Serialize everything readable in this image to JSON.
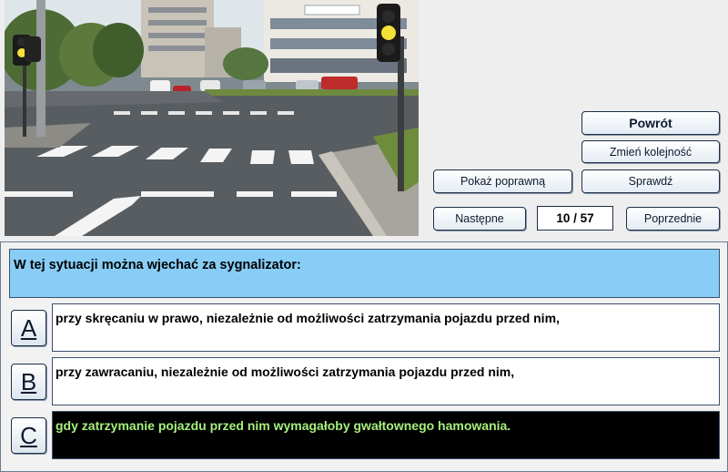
{
  "photo": {
    "alt_subject": "intersection-with-traffic-signal"
  },
  "buttons": {
    "back": "Powrót",
    "reorder": "Zmień kolejność",
    "show_correct": "Pokaż poprawną",
    "check": "Sprawdź",
    "next": "Następne",
    "previous": "Poprzednie"
  },
  "counter": "10 / 57",
  "question": "W tej sytuacji można wjechać za sygnalizator:",
  "answers": [
    {
      "letter": "A",
      "text": "przy skręcaniu w prawo, niezależnie od możliwości zatrzymania pojazdu przed nim,",
      "selected": false
    },
    {
      "letter": "B",
      "text": "przy zawracaniu, niezależnie od możliwości zatrzymania pojazdu przed nim,",
      "selected": false
    },
    {
      "letter": "C",
      "text": "gdy zatrzymanie pojazdu przed nim wymagałoby gwałtownego hamowania.",
      "selected": true
    }
  ],
  "colors": {
    "question_bg": "#88cdf6",
    "selected_bg": "#000000",
    "selected_text": "#a6f07e",
    "signal_yellow": "#f3e13a"
  }
}
